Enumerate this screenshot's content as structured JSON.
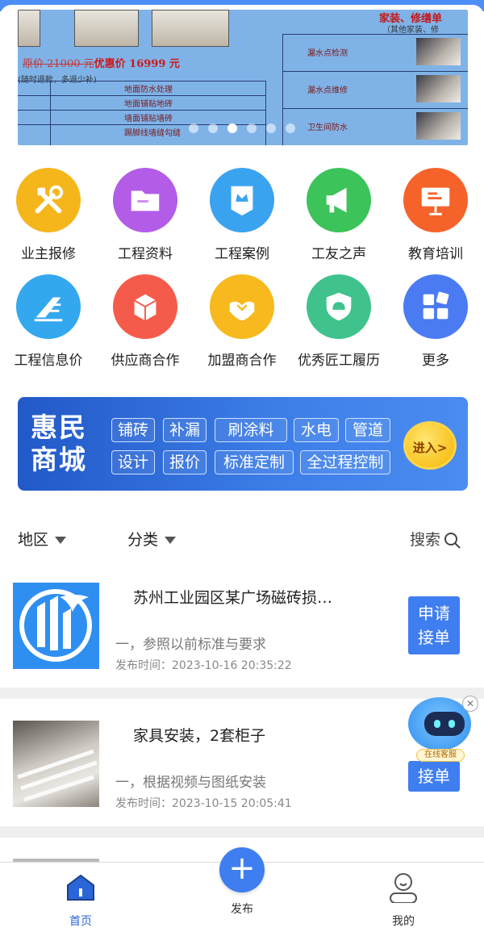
{
  "banner": {
    "promo_old": "原价 21000 元",
    "promo_new": "优惠价 16999 元",
    "note": "(随时退款，多退少补)",
    "right_title": "家装、修缮单",
    "right_sub": "（其他家装、修",
    "rows": [
      "地面防水处理",
      "地面铺贴地砖",
      "墙面铺贴墙砖",
      "踢脚线墙缝勾缝"
    ],
    "right_rows": [
      "漏水点检测",
      "漏水点维修",
      "卫生间防水"
    ],
    "slide_count": 6,
    "active_slide": 3
  },
  "grid": [
    {
      "label": "业主报修",
      "icon": "repair-tools-icon",
      "color": "#f5b61c"
    },
    {
      "label": "工程资料",
      "icon": "folder-icon",
      "color": "#b25ce8"
    },
    {
      "label": "工程案例",
      "icon": "crown-badge-icon",
      "color": "#3aa3ef"
    },
    {
      "label": "工友之声",
      "icon": "megaphone-icon",
      "color": "#3cc35a"
    },
    {
      "label": "教育培训",
      "icon": "presentation-board-icon",
      "color": "#f5632a"
    },
    {
      "label": "工程信息价",
      "icon": "price-chart-icon",
      "color": "#34a8ef"
    },
    {
      "label": "供应商合作",
      "icon": "package-box-icon",
      "color": "#f55b4a"
    },
    {
      "label": "加盟商合作",
      "icon": "handshake-icon",
      "color": "#f7b91d"
    },
    {
      "label": "优秀匠工履历",
      "icon": "helmet-shield-icon",
      "color": "#3fc28c"
    },
    {
      "label": "更多",
      "icon": "blocks-icon",
      "color": "#4a7bf2"
    }
  ],
  "mall": {
    "title": "惠民商城",
    "tags_row1": [
      "铺砖",
      "补漏",
      "刷涂料",
      "水电",
      "管道"
    ],
    "tags_row2": [
      "设计",
      "报价",
      "标准定制",
      "全过程控制"
    ],
    "enter": "进入>"
  },
  "filters": {
    "region": "地区",
    "category": "分类",
    "search": "搜索"
  },
  "items": [
    {
      "title": "苏州工业园区某广场磁砖损…",
      "desc": "一，参照以前标准与要求",
      "time": "发布时间：2023-10-16 20:35:22",
      "button": "申请接单",
      "button_line1": "申请",
      "button_line2": "接单"
    },
    {
      "title": "家具安装，2套柜子",
      "desc": "一，根据视频与图纸安装",
      "time": "发布时间：2023-10-15 20:05:41",
      "button_line2": "接单"
    }
  ],
  "cs": {
    "badge": "在线客服"
  },
  "tabbar": {
    "home": "首页",
    "publish": "发布",
    "publish_symbol": "+",
    "mine": "我的"
  }
}
